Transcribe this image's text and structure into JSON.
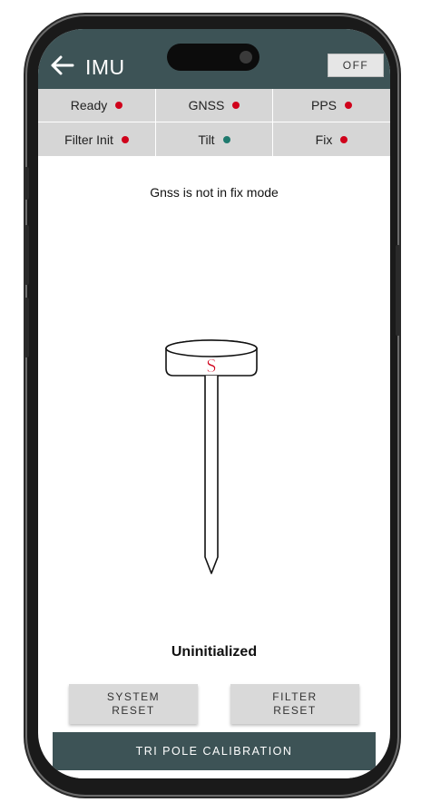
{
  "header": {
    "title": "IMU",
    "off_label": "OFF"
  },
  "status": [
    {
      "label": "Ready",
      "color": "#d0021b"
    },
    {
      "label": "GNSS",
      "color": "#d0021b"
    },
    {
      "label": "PPS",
      "color": "#d0021b"
    },
    {
      "label": "Filter Init",
      "color": "#d0021b"
    },
    {
      "label": "Tilt",
      "color": "#1f7a6e"
    },
    {
      "label": "Fix",
      "color": "#d0021b"
    }
  ],
  "message": "Gnss is not in fix mode",
  "pole": {
    "icon": "survey-pole-icon",
    "badge": "S",
    "badge_color": "#d0021b"
  },
  "state": "Uninitialized",
  "buttons": {
    "system_reset": [
      "SYSTEM",
      "RESET"
    ],
    "filter_reset": [
      "FILTER",
      "RESET"
    ],
    "calibration": "TRI POLE CALIBRATION"
  },
  "colors": {
    "accent": "#3d5356",
    "status_bg": "#d6d6d6",
    "error": "#d0021b",
    "ok": "#1f7a6e"
  }
}
